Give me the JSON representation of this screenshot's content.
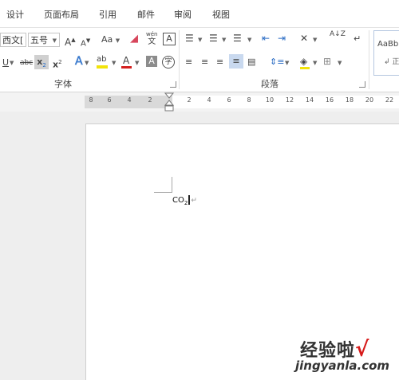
{
  "menu": {
    "tabs": [
      "设计",
      "页面布局",
      "引用",
      "邮件",
      "审阅",
      "视图"
    ]
  },
  "ribbon": {
    "font": {
      "font_name": "西文[",
      "font_size": "五号",
      "grow_label": "A",
      "shrink_label": "A",
      "case_label": "Aa",
      "phonetic_top": "wén",
      "phonetic_bottom": "文",
      "border_char": "A",
      "underline": "U",
      "strike": "abc",
      "subscript": "x",
      "subscript_sub": "2",
      "superscript": "x",
      "superscript_sup": "2",
      "effects": "A",
      "highlight": "ab",
      "font_color": "A",
      "shading_char": "A",
      "enclose_char": "字",
      "group_label": "字体"
    },
    "paragraph": {
      "group_label": "段落",
      "sort_label": "A↓Z"
    },
    "styles": {
      "sample_text": "AaBb",
      "sample_sub": "↲ 正"
    }
  },
  "ruler": {
    "left_ticks": [
      "8",
      "6",
      "4",
      "2"
    ],
    "right_ticks": [
      "2",
      "4",
      "6",
      "8",
      "10",
      "12",
      "14",
      "16",
      "18",
      "20",
      "22"
    ]
  },
  "document": {
    "text_main": "CO",
    "text_sub": "2",
    "paragraph_mark": "↵"
  },
  "watermark": {
    "title": "经验啦",
    "check": "√",
    "url": "jingyanla.com"
  },
  "colors": {
    "highlight_yellow": "#f2e30a",
    "font_red": "#d4201f",
    "subscript_active_bg": "#d0d0d0",
    "justify_active_bg": "#c9d9ef",
    "watermark_check": "#d71b1b"
  }
}
